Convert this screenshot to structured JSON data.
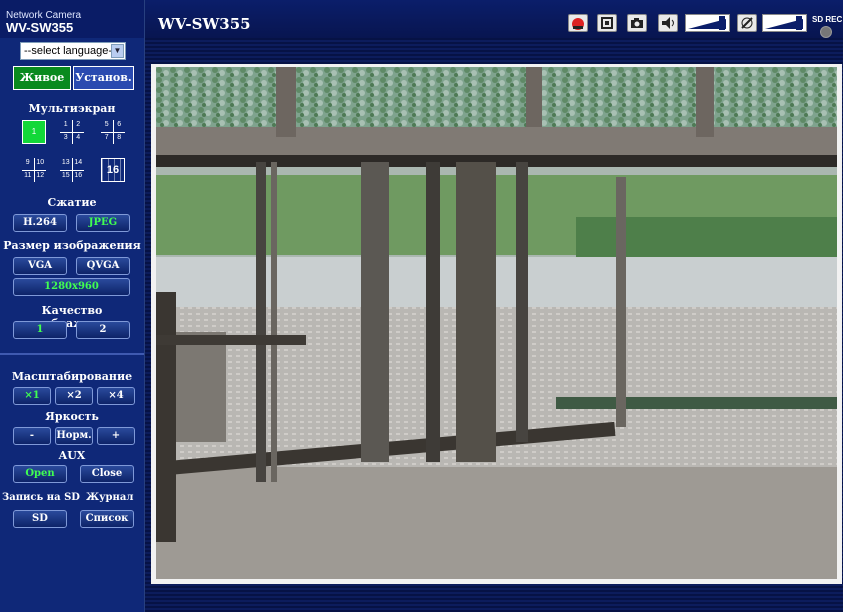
{
  "header": {
    "brand_sub": "Network Camera",
    "brand_model": "WV-SW355",
    "title": "WV-SW355",
    "sd_rec_label": "SD REC",
    "icons": [
      "alarm-icon",
      "fullscreen-icon",
      "snapshot-icon",
      "volume-icon",
      "volume-slider",
      "mic-mute-icon",
      "mic-slider"
    ]
  },
  "sidebar": {
    "language_placeholder": "--select language--",
    "tabs": {
      "live": "Живое",
      "setup": "Установ."
    },
    "multiscreen": {
      "title": "Мультиэкран",
      "single": "1",
      "quad_a": [
        "1",
        "2",
        "3",
        "4"
      ],
      "quad_b": [
        "5",
        "6",
        "7",
        "8"
      ],
      "quad_c": [
        "9",
        "10",
        "11",
        "12"
      ],
      "quad_d": [
        "13",
        "14",
        "15",
        "16"
      ],
      "sixteen": "16"
    },
    "compression": {
      "title": "Сжатие",
      "h264": "H.264",
      "jpeg": "JPEG"
    },
    "image_size": {
      "title": "Размер изображения",
      "vga": "VGA",
      "qvga": "QVGA",
      "large": "1280x960"
    },
    "image_quality": {
      "title": "Качество изображения",
      "q1": "1",
      "q2": "2"
    },
    "zoom": {
      "title": "Масштабирование",
      "x1": "×1",
      "x2": "×2",
      "x4": "×4"
    },
    "brightness": {
      "title": "Яркость",
      "minus": "-",
      "normal": "Норм.",
      "plus": "+"
    },
    "aux": {
      "title": "AUX",
      "open": "Open",
      "close": "Close"
    },
    "sd_record": {
      "title": "Запись на SD",
      "button": "SD"
    },
    "log": {
      "title": "Журнал",
      "button": "Список"
    }
  },
  "colors": {
    "active_green": "#40ff50",
    "live_tab": "#098a1e",
    "panel": "#0f2878"
  }
}
